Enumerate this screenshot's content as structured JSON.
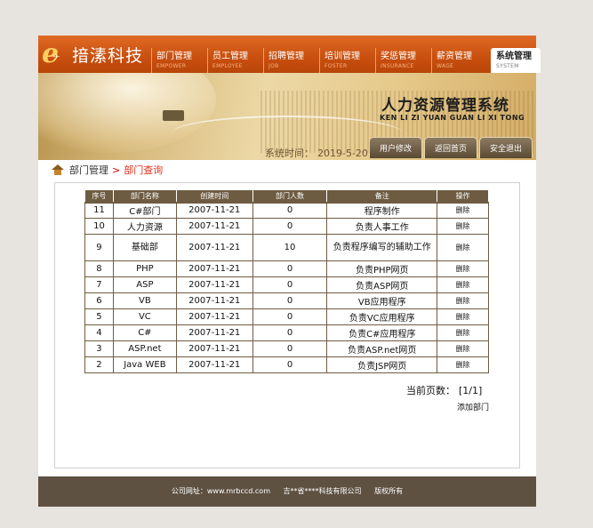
{
  "brand": {
    "name": "揞溸科技"
  },
  "nav": [
    {
      "cn": "部门管理",
      "en": "EMPOWER"
    },
    {
      "cn": "员工管理",
      "en": "EMPLOYEE"
    },
    {
      "cn": "招聘管理",
      "en": "JOB"
    },
    {
      "cn": "培训管理",
      "en": "FOSTER"
    },
    {
      "cn": "奖惩管理",
      "en": "INSURANCE"
    },
    {
      "cn": "薪资管理",
      "en": "WAGE"
    },
    {
      "cn": "系统管理",
      "en": "SYSTEM"
    }
  ],
  "banner": {
    "title": "人力资源管理系统",
    "pinyin": "KEN LI ZI YUAN GUAN LI XI TONG",
    "time_label": "系统时间：",
    "time_value": "2019-5-20"
  },
  "top_buttons": {
    "profile": "用户修改",
    "home": "返回首页",
    "logout": "安全退出"
  },
  "breadcrumb": {
    "root": "部门管理",
    "sep": ">",
    "current": "部门查询"
  },
  "table": {
    "headers": [
      "序号",
      "部门名称",
      "创建时间",
      "部门人数",
      "备注",
      "操作"
    ],
    "rows": [
      {
        "id": "11",
        "name": "C#部门",
        "created": "2007-11-21",
        "count": "0",
        "note": "程序制作",
        "op": "删除"
      },
      {
        "id": "10",
        "name": "人力资源",
        "created": "2007-11-21",
        "count": "0",
        "note": "负责人事工作",
        "op": "删除"
      },
      {
        "id": "9",
        "name": "基础部",
        "created": "2007-11-21",
        "count": "10",
        "note": "负责程序编写的辅助工作",
        "op": "删除"
      },
      {
        "id": "8",
        "name": "PHP",
        "created": "2007-11-21",
        "count": "0",
        "note": "负责PHP网页",
        "op": "删除"
      },
      {
        "id": "7",
        "name": "ASP",
        "created": "2007-11-21",
        "count": "0",
        "note": "负责ASP网页",
        "op": "删除"
      },
      {
        "id": "6",
        "name": "VB",
        "created": "2007-11-21",
        "count": "0",
        "note": "VB应用程序",
        "op": "删除"
      },
      {
        "id": "5",
        "name": "VC",
        "created": "2007-11-21",
        "count": "0",
        "note": "负责VC应用程序",
        "op": "删除"
      },
      {
        "id": "4",
        "name": "C#",
        "created": "2007-11-21",
        "count": "0",
        "note": "负责C#应用程序",
        "op": "删除"
      },
      {
        "id": "3",
        "name": "ASP.net",
        "created": "2007-11-21",
        "count": "0",
        "note": "负责ASP.net网页",
        "op": "删除"
      },
      {
        "id": "2",
        "name": "Java WEB",
        "created": "2007-11-21",
        "count": "0",
        "note": "负责JSP网页",
        "op": "删除"
      }
    ]
  },
  "pager": {
    "label": "当前页数：",
    "value": "[1/1]"
  },
  "add_link": "添加部门",
  "footer": {
    "site_label": "公司网址：www.mrbccd.com",
    "company": "吉**省****科技有限公司",
    "rights": "版权所有"
  }
}
